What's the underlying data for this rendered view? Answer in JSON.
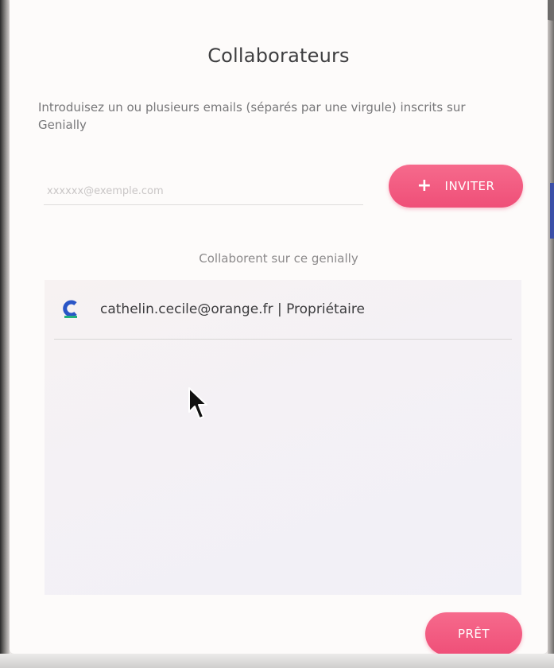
{
  "dialog": {
    "title": "Collaborateurs",
    "instructions": "Introduisez un ou plusieurs emails (séparés par une virgule) inscrits sur Genially",
    "email_input": {
      "placeholder": "xxxxxx@exemple.com",
      "value": ""
    },
    "invite_button": {
      "icon": "plus-icon",
      "label": "INVITER"
    },
    "collaborators_heading": "Collaborent sur ce genially",
    "collaborators": [
      {
        "avatar_icon": "genially-logo-icon",
        "text": "cathelin.cecile@orange.fr | Propriétaire"
      }
    ],
    "done_button": {
      "label": "PRÊT"
    }
  },
  "colors": {
    "accent": "#ef4f78",
    "title": "#3e3e40",
    "muted_text": "#777779",
    "panel_background": "#f5f2f4",
    "avatar_blue": "#2a56c6",
    "avatar_green": "#22b07d"
  }
}
